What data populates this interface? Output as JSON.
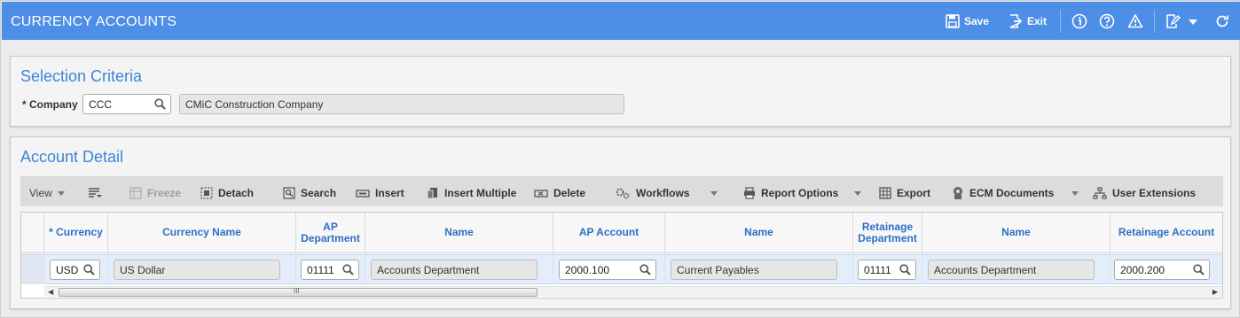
{
  "app": {
    "title": "CURRENCY ACCOUNTS"
  },
  "titlebar": {
    "save_label": "Save",
    "exit_label": "Exit"
  },
  "selection": {
    "title": "Selection Criteria",
    "company_label": "* Company",
    "company_value": "CCC",
    "company_name": "CMiC Construction Company"
  },
  "account_detail": {
    "title": "Account Detail",
    "toolbar": {
      "view": "View",
      "freeze": "Freeze",
      "detach": "Detach",
      "search": "Search",
      "insert": "Insert",
      "insert_multiple": "Insert Multiple",
      "delete": "Delete",
      "workflows": "Workflows",
      "report_options": "Report Options",
      "export": "Export",
      "ecm_documents": "ECM Documents",
      "user_extensions": "User Extensions"
    },
    "columns": {
      "currency": "* Currency",
      "currency_name": "Currency Name",
      "ap_department": "AP Department",
      "name1": "Name",
      "ap_account": "AP Account",
      "name2": "Name",
      "retainage_department": "Retainage Department",
      "name3": "Name",
      "retainage_account": "Retainage Account"
    },
    "rows": [
      {
        "currency": "USD",
        "currency_name": "US Dollar",
        "ap_department": "01111",
        "ap_department_name": "Accounts Department",
        "ap_account": "2000.100",
        "ap_account_name": "Current Payables",
        "retainage_department": "01111",
        "retainage_department_name": "Accounts Department",
        "retainage_account": "2000.200"
      }
    ]
  },
  "colors": {
    "titlebar": "#4d8ee6",
    "panel_title": "#3d84d8",
    "header_text": "#2f6fc4",
    "selected_row": "#e4eefb"
  }
}
